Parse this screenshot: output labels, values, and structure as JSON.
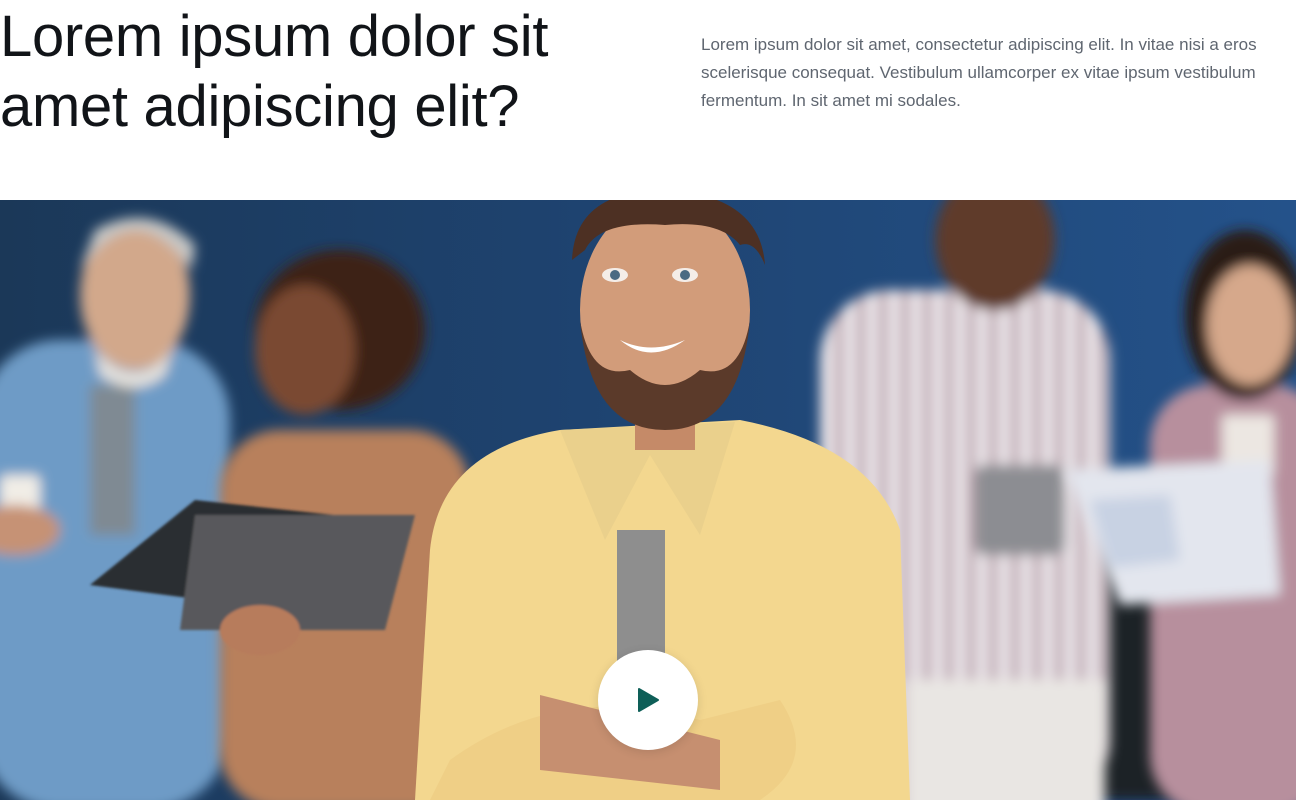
{
  "hero": {
    "title": "Lorem ipsum dolor sit amet adipiscing elit?",
    "description": "Lorem ipsum dolor sit amet, consectetur adipiscing elit. In vitae nisi a eros scelerisque consequat. Vestibulum ullamcorper ex vitae ipsum vestibulum fermentum. In sit amet mi sodales."
  },
  "video": {
    "play_icon": "play-icon",
    "accent_color": "#0e5f58"
  },
  "colors": {
    "title_text": "#111418",
    "body_text": "#5f6670",
    "background": "#ffffff",
    "wall": "#1d3f63"
  }
}
